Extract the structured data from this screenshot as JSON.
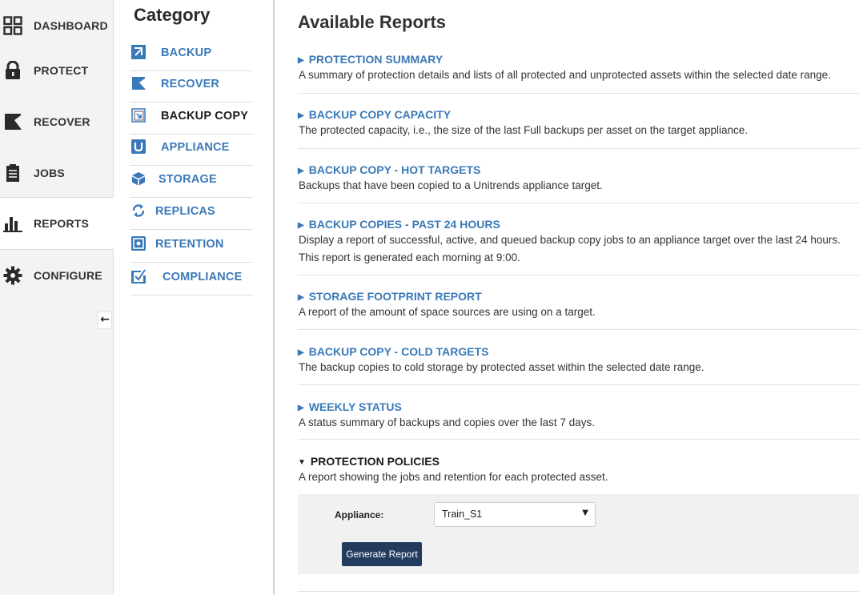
{
  "nav": {
    "items": [
      {
        "label": "DASHBOARD",
        "icon": "dashboard-grid-icon"
      },
      {
        "label": "PROTECT",
        "icon": "lock-icon"
      },
      {
        "label": "RECOVER",
        "icon": "recover-arrow-icon"
      },
      {
        "label": "JOBS",
        "icon": "clipboard-icon"
      },
      {
        "label": "REPORTS",
        "icon": "bar-chart-icon",
        "active": true
      },
      {
        "label": "CONFIGURE",
        "icon": "gear-icon"
      }
    ],
    "collapse_glyph": "←"
  },
  "category": {
    "title": "Category",
    "items": [
      {
        "label": "BACKUP",
        "icon": "backup-icon"
      },
      {
        "label": "RECOVER",
        "icon": "recover-icon"
      },
      {
        "label": "BACKUP COPY",
        "icon": "backup-copy-icon",
        "selected": true
      },
      {
        "label": "APPLIANCE",
        "icon": "appliance-icon"
      },
      {
        "label": "STORAGE",
        "icon": "storage-icon"
      },
      {
        "label": "REPLICAS",
        "icon": "replicas-icon"
      },
      {
        "label": "RETENTION",
        "icon": "retention-icon"
      },
      {
        "label": "COMPLIANCE",
        "icon": "compliance-icon"
      }
    ]
  },
  "main": {
    "title": "Available Reports",
    "reports": [
      {
        "title": "PROTECTION SUMMARY",
        "desc": [
          "A summary of protection details and lists of all protected and unprotected assets within the selected date range."
        ]
      },
      {
        "title": "BACKUP COPY CAPACITY",
        "desc": [
          "The protected capacity, i.e., the size of the last Full backups per asset on the target appliance."
        ]
      },
      {
        "title": "BACKUP COPY - HOT TARGETS",
        "desc": [
          "Backups that have been copied to a Unitrends appliance target."
        ]
      },
      {
        "title": "BACKUP COPIES - PAST 24 HOURS",
        "desc": [
          "Display a report of successful, active, and queued backup copy jobs to an appliance target over the last 24 hours.",
          "This report is generated each morning at 9:00."
        ]
      },
      {
        "title": "STORAGE FOOTPRINT REPORT",
        "desc": [
          "A report of the amount of space sources are using on a target."
        ]
      },
      {
        "title": "BACKUP COPY - COLD TARGETS",
        "desc": [
          "The backup copies to cold storage by protected asset within the selected date range."
        ]
      },
      {
        "title": "WEEKLY STATUS",
        "desc": [
          "A status summary of backups and copies over the last 7 days."
        ]
      },
      {
        "title": "PROTECTION POLICIES",
        "desc": [
          "A report showing the jobs and retention for each protected asset."
        ],
        "expanded": true
      }
    ],
    "closed_marker": "▶",
    "open_marker": "▼",
    "policy_form": {
      "appliance_label": "Appliance:",
      "appliance_value": "Train_S1",
      "generate_label": "Generate Report"
    }
  },
  "colors": {
    "link": "#3a79b8",
    "button": "#233c5e",
    "nav_bg": "#f3f3f3"
  }
}
